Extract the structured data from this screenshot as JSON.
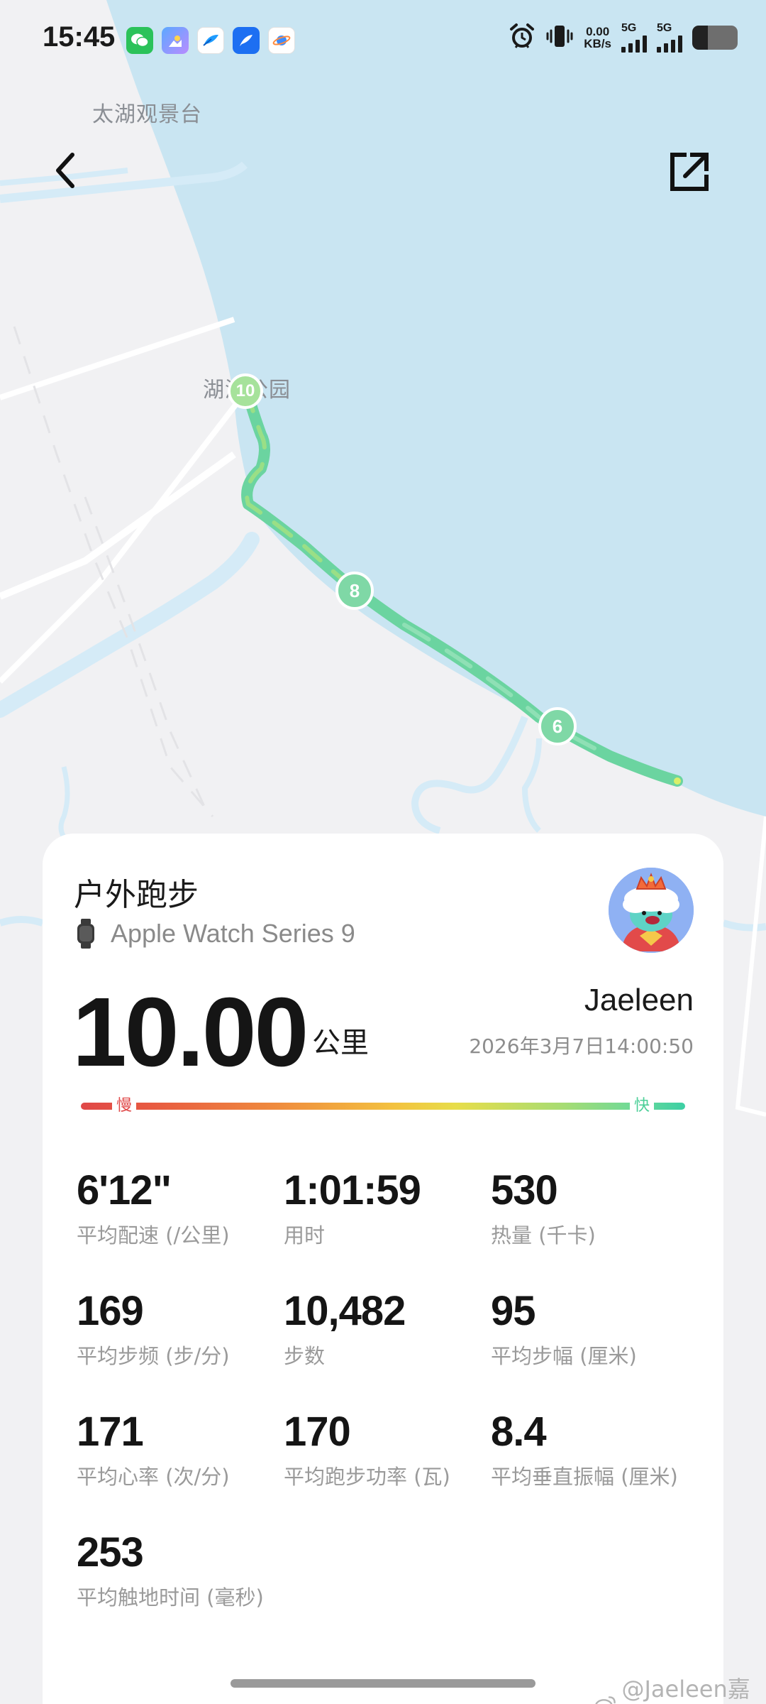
{
  "status_bar": {
    "time": "15:45",
    "net_speed_value": "0.00",
    "net_speed_unit": "KB/s",
    "sim1_label": "5G",
    "sim2_label": "5G",
    "battery_level": 0.35,
    "notification_icons": [
      "wechat-icon",
      "photos-app-icon",
      "feather-app-icon",
      "feather-app-icon-blue",
      "browser-planet-icon"
    ],
    "system_icons": [
      "alarm-icon",
      "vibrate-icon",
      "signal-icon",
      "battery-icon"
    ]
  },
  "map": {
    "labels": {
      "taihu_viewpoint": "太湖观景台",
      "park": "湖滨公园"
    },
    "kilometer_markers": [
      "10",
      "8",
      "6"
    ],
    "colors": {
      "water": "#c9e5f2",
      "land": "#f1f1f3",
      "river": "#d5ebf7",
      "road": "#ffffff",
      "route_primary": "#6bd4a0",
      "route_secondary": "#9adf86",
      "marker_fill": "#7fd8a6"
    }
  },
  "nav": {
    "back_icon": "chevron-left-icon",
    "share_icon": "external-share-icon"
  },
  "summary": {
    "workout_type": "户外跑步",
    "device_name": "Apple Watch Series 9",
    "device_icon": "watch-icon",
    "distance": "10.00",
    "distance_unit": "公里",
    "user_name": "Jaeleen",
    "date": "2026年3月7日14:00:50",
    "avatar_icon": "cartoon-avatar",
    "pace_scale": {
      "slow_label": "慢",
      "fast_label": "快",
      "slow_color": "#e04848",
      "fast_color": "#3ccfa4"
    }
  },
  "stats": [
    {
      "value": "6'12\"",
      "label": "平均配速 (/公里)"
    },
    {
      "value": "1:01:59",
      "label": "用时"
    },
    {
      "value": "530",
      "label": "热量 (千卡)"
    },
    {
      "value": "169",
      "label": "平均步频 (步/分)"
    },
    {
      "value": "10,482",
      "label": "步数"
    },
    {
      "value": "95",
      "label": "平均步幅 (厘米)"
    },
    {
      "value": "171",
      "label": "平均心率 (次/分)"
    },
    {
      "value": "170",
      "label": "平均跑步功率 (瓦)"
    },
    {
      "value": "8.4",
      "label": "平均垂直振幅 (厘米)"
    },
    {
      "value": "253",
      "label": "平均触地时间 (毫秒)"
    }
  ],
  "watermark": {
    "text": "@Jaeleen嘉颖",
    "icon": "weibo-icon"
  }
}
